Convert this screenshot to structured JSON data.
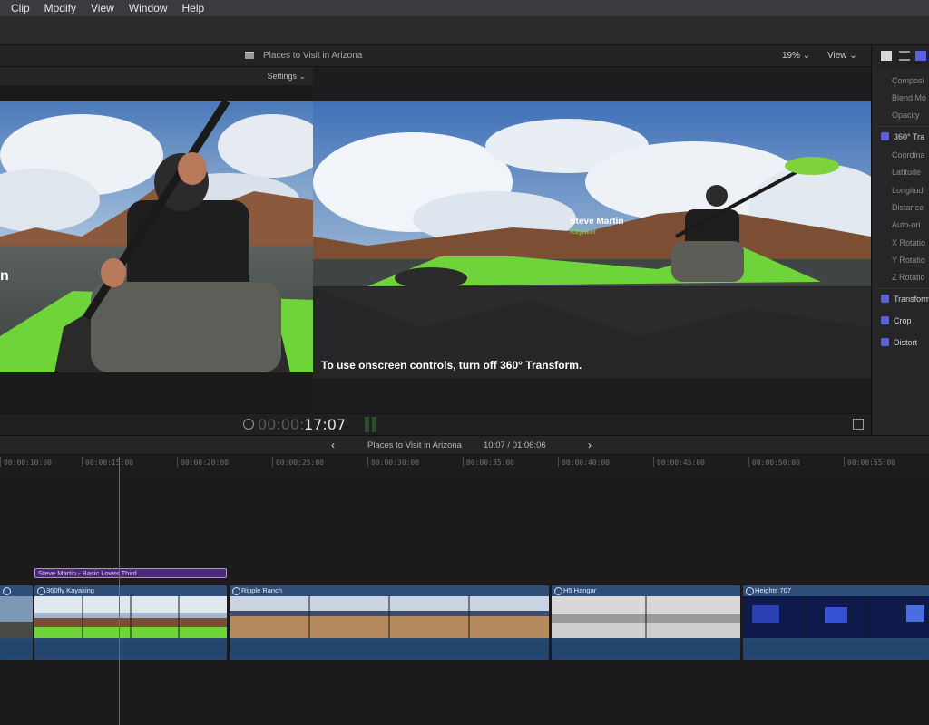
{
  "menu": [
    "Clip",
    "Modify",
    "View",
    "Window",
    "Help"
  ],
  "viewer": {
    "project_title": "Places to Visit in Arizona",
    "zoom": "19% ⌄",
    "view_menu": "View ⌄",
    "settings": "Settings ⌄",
    "left_overlay_text": "n",
    "overlay_message": "To use onscreen controls, turn off 360° Transform.",
    "lower_third_name": "Steve Martin",
    "lower_third_sub": "Kayaker",
    "timecode_dim": "00:00:",
    "timecode_bright": "17:07"
  },
  "inspector": {
    "rows_top": [
      "Composi",
      "Blend Mo",
      "Opacity"
    ],
    "section_360": "360° Tra",
    "rows_360": [
      "Coordina",
      "Latitude",
      "Longitud",
      "Distance",
      "Auto-ori",
      "X Rotatio",
      "Y Rotatio",
      "Z Rotatio"
    ],
    "checks": [
      "Transform",
      "Crop",
      "Distort"
    ]
  },
  "timeline": {
    "prev": "‹",
    "title": "Places to Visit in Arizona",
    "time": "10:07 / 01:06:06",
    "next": "›",
    "ruler": [
      "00:00:10:00",
      "00:00:15:00",
      "00:00:20:00",
      "00:00:25:00",
      "00:00:30:00",
      "00:00:35:00",
      "00:00:40:00",
      "00:00:45:00",
      "00:00:50:00",
      "00:00:55:00"
    ],
    "title_clip": "Steve Martin - Basic Lower Third",
    "clips": [
      "360fly Kayaking",
      "Ripple Ranch",
      "H5 Hangar",
      "Heights 707"
    ]
  },
  "colors": {
    "accent": "#5b5fe0",
    "playhead": "#c04a2a",
    "clip_blue": "#2a4970",
    "title_purple": "#4a2a78",
    "kayak_green": "#6fd33a"
  }
}
